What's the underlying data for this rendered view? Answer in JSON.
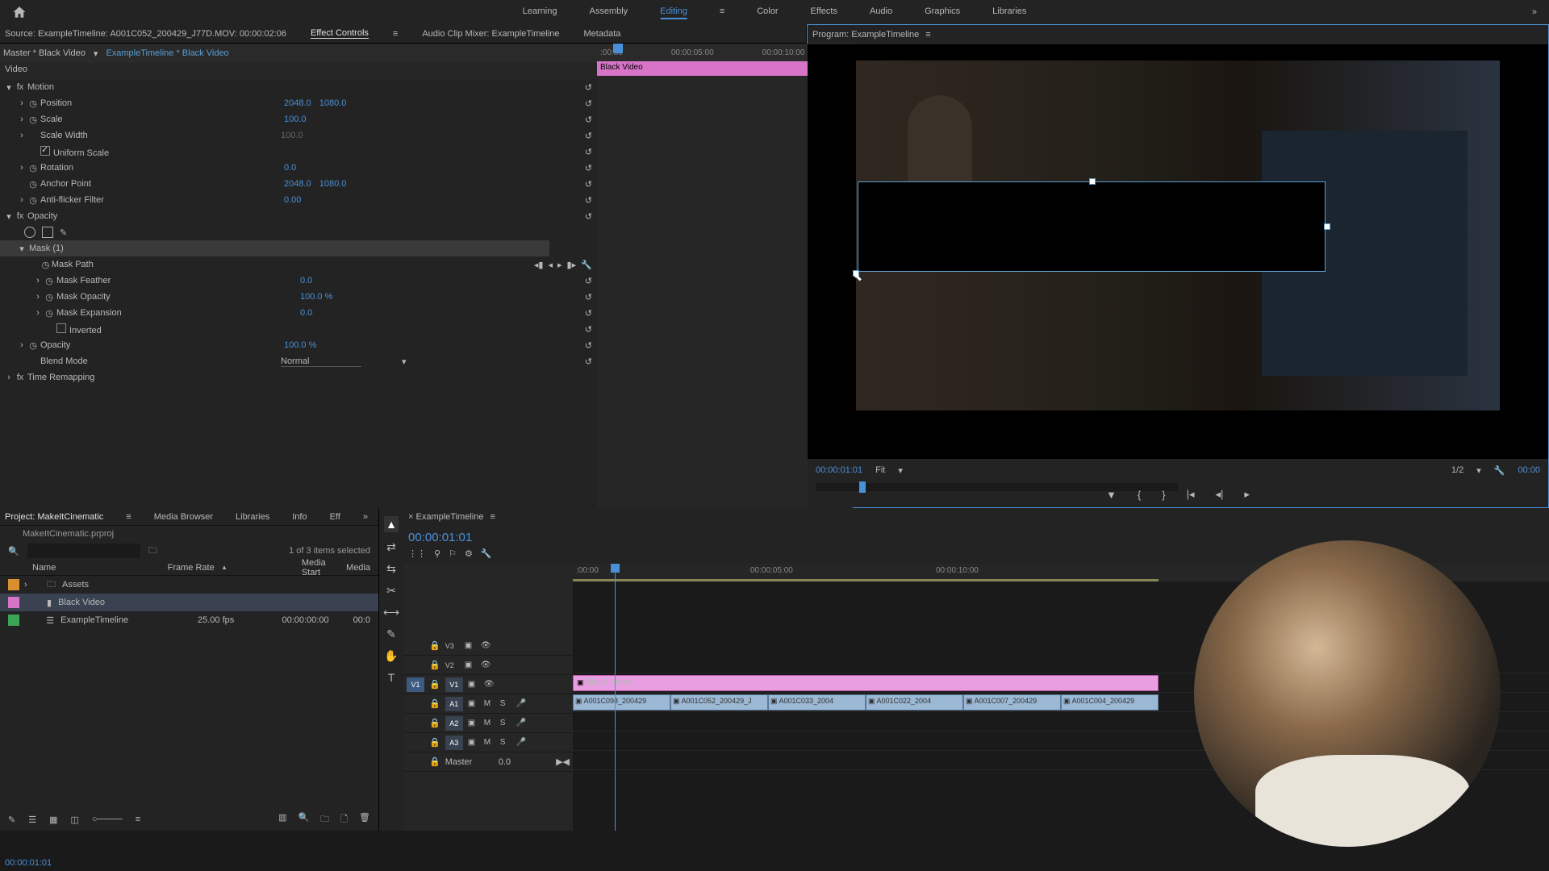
{
  "topbar": {
    "workspaces": [
      "Learning",
      "Assembly",
      "Editing",
      "Color",
      "Effects",
      "Audio",
      "Graphics",
      "Libraries"
    ],
    "active": "Editing"
  },
  "source_panel": {
    "source_label": "Source: ExampleTimeline: A001C052_200429_J77D.MOV: 00:00:02:06",
    "tabs": {
      "effect_controls": "Effect Controls",
      "audio_mixer": "Audio Clip Mixer: ExampleTimeline",
      "metadata": "Metadata"
    },
    "timecode": "00:00:01:01"
  },
  "effect_controls": {
    "master": "Master * Black Video",
    "clip": "ExampleTimeline * Black Video",
    "video_header": "Video",
    "motion": {
      "label": "Motion",
      "position": {
        "label": "Position",
        "x": "2048.0",
        "y": "1080.0"
      },
      "scale": {
        "label": "Scale",
        "v": "100.0"
      },
      "scale_width": {
        "label": "Scale Width",
        "v": "100.0"
      },
      "uniform": {
        "label": "Uniform Scale"
      },
      "rotation": {
        "label": "Rotation",
        "v": "0.0"
      },
      "anchor": {
        "label": "Anchor Point",
        "x": "2048.0",
        "y": "1080.0"
      },
      "antiflicker": {
        "label": "Anti-flicker Filter",
        "v": "0.00"
      }
    },
    "opacity": {
      "label": "Opacity",
      "mask": {
        "label": "Mask (1)"
      },
      "mask_path": {
        "label": "Mask Path"
      },
      "mask_feather": {
        "label": "Mask Feather",
        "v": "0.0"
      },
      "mask_opacity": {
        "label": "Mask Opacity",
        "v": "100.0 %"
      },
      "mask_expansion": {
        "label": "Mask Expansion",
        "v": "0.0"
      },
      "inverted": {
        "label": "Inverted"
      },
      "opacity_v": {
        "label": "Opacity",
        "v": "100.0 %"
      },
      "blend": {
        "label": "Blend Mode",
        "v": "Normal"
      }
    },
    "time_remap": "Time Remapping",
    "ruler": {
      "t0": ":00:00",
      "t1": "00:00:05:00",
      "t2": "00:00:10:00"
    },
    "clip_bar": "Black Video"
  },
  "program": {
    "title": "Program: ExampleTimeline",
    "timecode": "00:00:01:01",
    "fit": "Fit",
    "quality": "1/2",
    "tc_right": "00:00"
  },
  "project": {
    "tabs": {
      "project": "Project: MakeItCinematic",
      "media": "Media Browser",
      "libraries": "Libraries",
      "info": "Info",
      "eff": "Eff"
    },
    "file": "MakeItCinematic.prproj",
    "selected": "1 of 3 items selected",
    "cols": {
      "name": "Name",
      "rate": "Frame Rate",
      "start": "Media Start",
      "end": "Media"
    },
    "rows": [
      {
        "color": "#d88f2e",
        "name": "Assets",
        "rate": "",
        "start": ""
      },
      {
        "color": "#d874c8",
        "name": "Black Video",
        "rate": "",
        "start": "",
        "sel": true
      },
      {
        "color": "#3aa655",
        "name": "ExampleTimeline",
        "rate": "25.00 fps",
        "start": "00:00:00:00",
        "end": "00:0"
      }
    ]
  },
  "timeline": {
    "tab": "ExampleTimeline",
    "timecode": "00:00:01:01",
    "ruler": {
      "t0": ":00:00",
      "t1": "00:00:05:00",
      "t2": "00:00:10:00"
    },
    "tracks": {
      "v3": "V3",
      "v2": "V2",
      "v1": "V1",
      "a1": "A1",
      "a2": "A2",
      "a3": "A3",
      "master": "Master",
      "master_v": "0.0"
    },
    "v2_clip": "Black Video",
    "v1_clips": [
      {
        "label": "A001C098_200429",
        "left": "0%",
        "w": "10%"
      },
      {
        "label": "A001C052_200429_J",
        "left": "10%",
        "w": "10%"
      },
      {
        "label": "A001C033_2004",
        "left": "20%",
        "w": "10%"
      },
      {
        "label": "A001C022_2004",
        "left": "30%",
        "w": "10%"
      },
      {
        "label": "A001C007_200429",
        "left": "40%",
        "w": "10%"
      },
      {
        "label": "A001C004_200429",
        "left": "50%",
        "w": "10%"
      }
    ],
    "buttons": {
      "m": "M",
      "s": "S"
    }
  }
}
